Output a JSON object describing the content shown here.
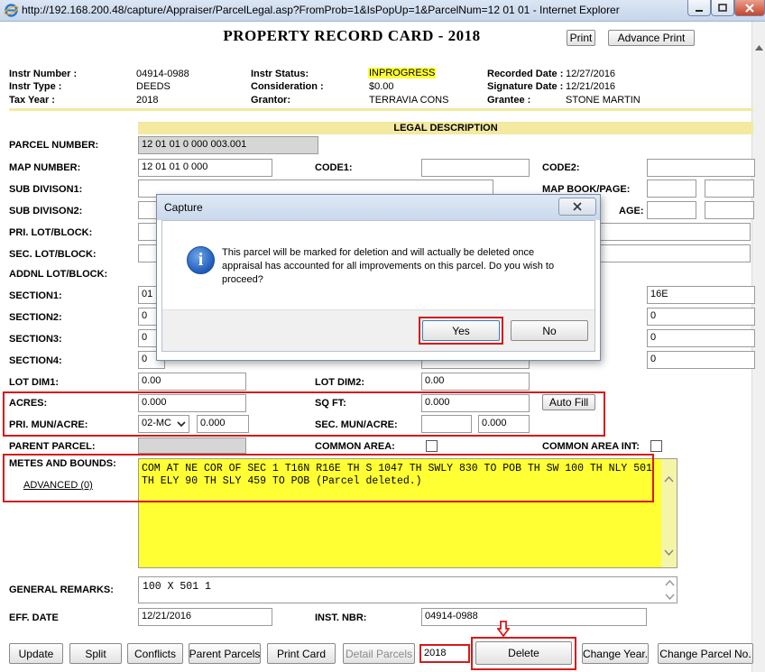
{
  "window": {
    "title": "http://192.168.200.48/capture/Appraiser/ParcelLegal.asp?FromProb=1&IsPopUp=1&ParcelNum=12 01 01 - Internet Explorer"
  },
  "page": {
    "title": "PROPERTY RECORD CARD - 2018",
    "print_label": "Print",
    "advance_print_label": "Advance Print"
  },
  "header_info": {
    "instr_number_label": "Instr Number :",
    "instr_number": "04914-0988",
    "instr_type_label": "Instr Type :",
    "instr_type": "DEEDS",
    "tax_year_label": "Tax Year :",
    "tax_year": "2018",
    "instr_status_label": "Instr Status:",
    "instr_status": "INPROGRESS",
    "consideration_label": "Consideration :",
    "consideration": "$0.00",
    "grantor_label": "Grantor:",
    "grantor": "TERRAVIA CONS",
    "recorded_date_label": "Recorded Date :",
    "recorded_date": "12/27/2016",
    "signature_date_label": "Signature Date :",
    "signature_date": "12/21/2016",
    "grantee_label": "Grantee :",
    "grantee": "STONE MARTIN"
  },
  "legal": {
    "section_title": "LEGAL DESCRIPTION",
    "parcel_number_label": "PARCEL NUMBER:",
    "parcel_number": "12 01 01 0 000 003.001",
    "map_number_label": "MAP NUMBER:",
    "map_number": "12 01 01 0 000",
    "code1_label": "CODE1:",
    "code1": "",
    "code2_label": "CODE2:",
    "code2": "",
    "sub_div1_label": "SUB DIVISON1:",
    "sub_div2_label": "SUB DIVISON2:",
    "map_book_page_label": "MAP BOOK/PAGE:",
    "page_partial_label": "AGE:",
    "pri_lot_label": "PRI. LOT/BLOCK:",
    "sec_lot_label": "SEC. LOT/BLOCK:",
    "addnl_lot_label": "ADDNL LOT/BLOCK:",
    "section1_label": "SECTION1:",
    "section1": "01",
    "section1_range": "16E",
    "section2_label": "SECTION2:",
    "section2": "0",
    "section2_range": "0",
    "section3_label": "SECTION3:",
    "section3": "0",
    "section3_range": "0",
    "section4_label": "SECTION4:",
    "section4": "0",
    "section4_range": "0",
    "lot_dim1_label": "LOT DIM1:",
    "lot_dim1": "0.00",
    "lot_dim2_label": "LOT DIM2:",
    "lot_dim2": "0.00",
    "acres_label": "ACRES:",
    "acres": "0.000",
    "sq_ft_label": "SQ FT:",
    "sq_ft": "0.000",
    "auto_fill_label": "Auto Fill",
    "pri_mun_label": "PRI. MUN/ACRE:",
    "pri_mun_select": "02-MC",
    "pri_mun_value": "0.000",
    "sec_mun_label": "SEC. MUN/ACRE:",
    "sec_mun_code": "",
    "sec_mun_value": "0.000",
    "parent_parcel_label": "PARENT PARCEL:",
    "common_area_label": "COMMON AREA:",
    "common_area_int_label": "COMMON AREA INT:",
    "metes_label": "METES AND BOUNDS:",
    "advanced_link": "ADVANCED (0)",
    "metes_text": "COM AT NE COR OF SEC 1 T16N R16E TH S 1047 TH SWLY 830 TO POB TH SW 100 TH NLY 501 TH ELY 90 TH SLY 459 TO POB (Parcel deleted.)",
    "general_remarks_label": "GENERAL REMARKS:",
    "general_remarks": "100 X 501 1",
    "eff_date_label": "EFF. DATE",
    "eff_date": "12/21/2016",
    "inst_nbr_label": "INST. NBR:",
    "inst_nbr": "04914-0988"
  },
  "toolbar": {
    "update": "Update",
    "split": "Split",
    "conflicts": "Conflicts",
    "parent_parcels": "Parent Parcels",
    "print_card": "Print Card",
    "detail_parcels": "Detail Parcels",
    "year_value": "2018",
    "delete": "Delete",
    "change_year": "Change Year.",
    "change_parcel_no": "Change Parcel No."
  },
  "dialog": {
    "title": "Capture",
    "message": "This parcel will be marked for deletion and will actually be deleted once appraisal has accounted for all improvements on this parcel. Do you wish to proceed?",
    "yes_label": "Yes",
    "no_label": "No"
  },
  "colors": {
    "highlight_red": "#d61a1a",
    "highlight_yellow": "#ffff33",
    "section_tan": "#f3e9a0"
  }
}
